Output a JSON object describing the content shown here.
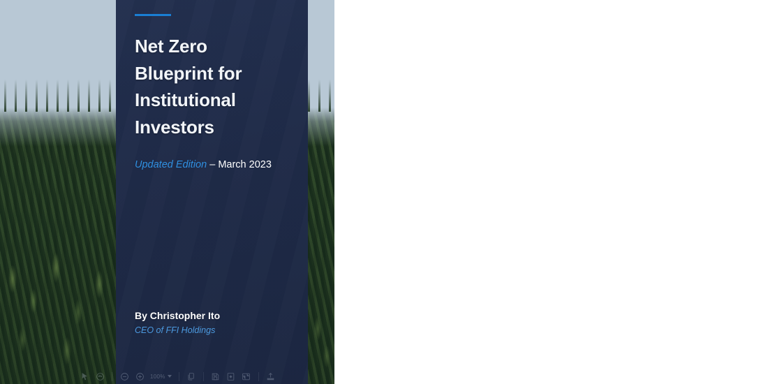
{
  "document": {
    "accent_color": "#1a7fd4",
    "panel_color": "#1f2b48",
    "title_lines": [
      "Net Zero",
      "Blueprint for",
      "Institutional",
      "Investors"
    ],
    "title_full": "Net Zero Blueprint for Institutional Investors",
    "edition_label": "Updated Edition",
    "edition_separator": " – ",
    "edition_date": "March 2023",
    "author": "By Christopher Ito",
    "author_role": "CEO of FFI Holdings"
  },
  "toolbar": {
    "zoom_out_icon": "zoom-out-icon",
    "zoom_in_icon": "zoom-in-icon",
    "zoom_level": "100%",
    "caret_icon": "chevron-down-icon",
    "copy_icon": "copy-pages-icon",
    "save_icon": "save-icon",
    "fit_page_icon": "fit-page-icon",
    "fit_width_icon": "fit-width-icon",
    "upload_icon": "upload-icon",
    "select_tool_icon": "cursor-select-icon",
    "pan_tool_icon": "hand-pan-icon"
  }
}
